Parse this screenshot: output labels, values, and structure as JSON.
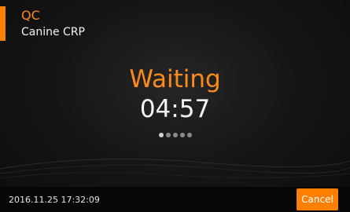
{
  "header": {
    "title": "QC",
    "subtitle": "Canine CRP"
  },
  "status": {
    "label": "Waiting",
    "countdown": "04:57"
  },
  "progress_dots": {
    "total": 5,
    "active": 1
  },
  "footer": {
    "datetime": "2016.11.25   17:32:09",
    "cancel_label": "Cancel"
  },
  "colors": {
    "accent": "#ff8200",
    "background": "#0d0d0d",
    "text": "#f2f2f2"
  }
}
